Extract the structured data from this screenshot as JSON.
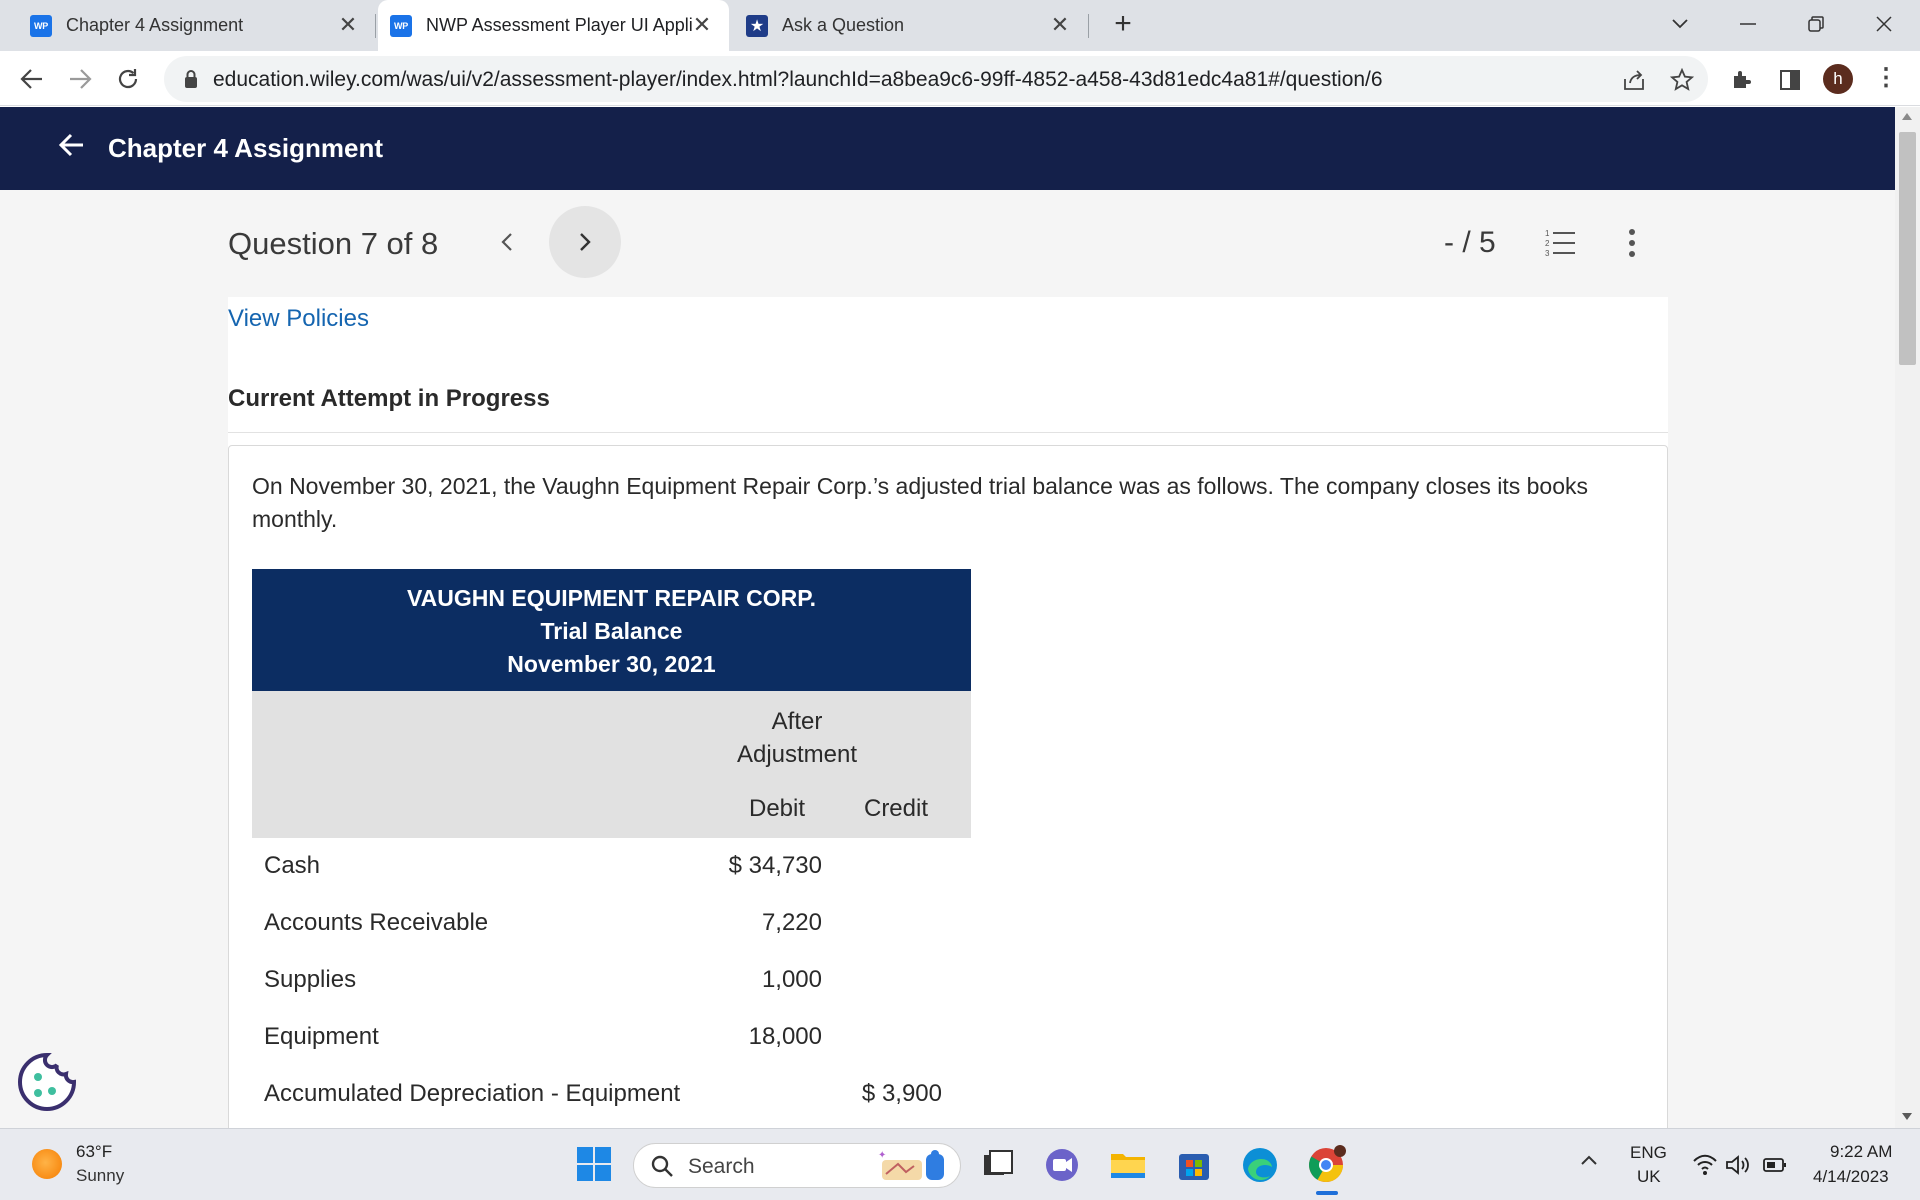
{
  "browser": {
    "tabs": [
      {
        "favicon": "WP",
        "title": "Chapter 4 Assignment",
        "active": false
      },
      {
        "favicon": "WP",
        "title": "NWP Assessment Player UI Appli",
        "active": true
      },
      {
        "favicon": "star",
        "title": "Ask a Question",
        "active": false
      }
    ],
    "url": "education.wiley.com/was/ui/v2/assessment-player/index.html?launchId=a8bea9c6-99ff-4852-a458-43d81edc4a81#/question/6",
    "profile_initial": "h"
  },
  "header": {
    "title": "Chapter 4 Assignment"
  },
  "question_nav": {
    "counter": "Question 7 of 8",
    "score": "- / 5"
  },
  "content": {
    "view_policies": "View Policies",
    "attempt_status": "Current Attempt in Progress",
    "question_text": "On November 30, 2021, the Vaughn Equipment Repair Corp.’s adjusted trial balance was as follows. The company closes its books monthly."
  },
  "trial_balance": {
    "company": "VAUGHN EQUIPMENT REPAIR CORP.",
    "statement": "Trial Balance",
    "date": "November 30, 2021",
    "column_group_line1": "After",
    "column_group_line2": "Adjustment",
    "debit_header": "Debit",
    "credit_header": "Credit",
    "rows": [
      {
        "account": "Cash",
        "debit": "$ 34,730",
        "credit": ""
      },
      {
        "account": "Accounts Receivable",
        "debit": "7,220",
        "credit": ""
      },
      {
        "account": "Supplies",
        "debit": "1,000",
        "credit": ""
      },
      {
        "account": "Equipment",
        "debit": "18,000",
        "credit": ""
      },
      {
        "account": "Accumulated Depreciation - Equipment",
        "debit": "",
        "credit": "$ 3,900"
      }
    ]
  },
  "taskbar": {
    "weather_temp": "63°F",
    "weather_desc": "Sunny",
    "search_placeholder": "Search",
    "lang_line1": "ENG",
    "lang_line2": "UK",
    "time": "9:22 AM",
    "date": "4/14/2023"
  }
}
